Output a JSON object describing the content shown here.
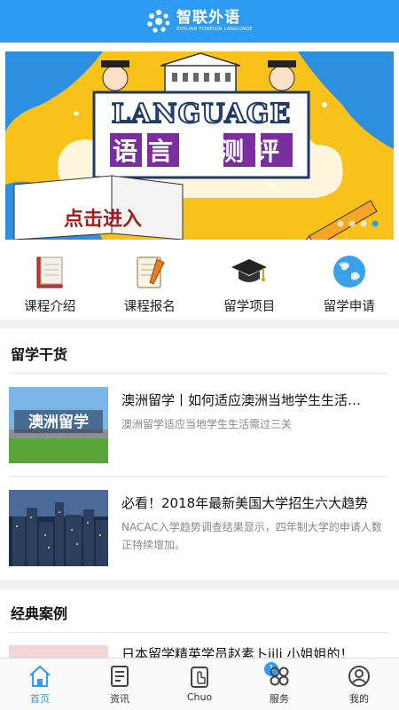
{
  "header": {
    "brand_cn": "智联外语",
    "brand_en": "ZHILIAN FOREIGN LANGUAGE",
    "color": "#2d9cf2"
  },
  "banner": {
    "headline_en": "LANGUAGE",
    "headline_cn": "语言一测评",
    "cta": "点击进入",
    "page_dots": 4,
    "active_dot": 4
  },
  "quicknav": [
    {
      "label": "课程介绍",
      "icon": "book-icon"
    },
    {
      "label": "课程报名",
      "icon": "notebook-pen-icon"
    },
    {
      "label": "留学项目",
      "icon": "graduation-cap-icon"
    },
    {
      "label": "留学申请",
      "icon": "globe-icon"
    }
  ],
  "section_study": {
    "title": "留学干货",
    "articles": [
      {
        "thumb_text": "澳洲留学",
        "title": "澳洲留学丨如何适应澳洲当地学生生活…",
        "desc": "澳洲留学适应当地学生生活需过三关"
      },
      {
        "title": "必看！2018年最新美国大学招生六大趋势",
        "desc": "NACAC入学趋势调查结果显示，四年制大学的申请人数正持续增加。"
      }
    ]
  },
  "section_cases": {
    "title": "经典案例",
    "peek_title": "日本留学精英学员赵素卜iili 小姐姐的！"
  },
  "tabbar": [
    {
      "label": "首页",
      "icon": "home-icon",
      "active": true
    },
    {
      "label": "资讯",
      "icon": "news-icon"
    },
    {
      "label": "Chuo",
      "icon": "tap-icon",
      "badge": "1"
    },
    {
      "label": "服务",
      "icon": "apps-icon"
    },
    {
      "label": "我的",
      "icon": "profile-icon"
    }
  ]
}
